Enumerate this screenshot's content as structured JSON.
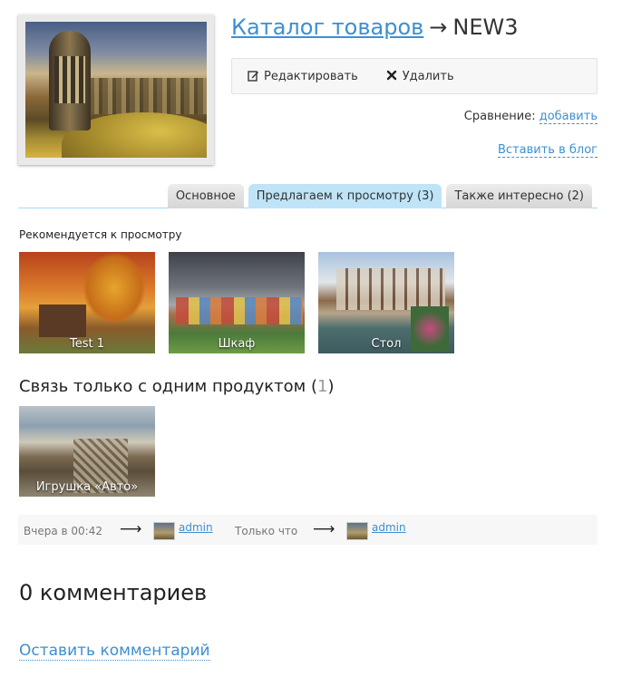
{
  "header": {
    "catalog_link": "Каталог товаров",
    "arrow": "→",
    "product_name": "NEW3"
  },
  "actions": {
    "edit_label": "Редактировать",
    "delete_label": "Удалить"
  },
  "compare": {
    "label": "Сравнение:",
    "add_link": "добавить"
  },
  "embed_link": "Вставить в блог",
  "tabs": [
    {
      "label": "Основное"
    },
    {
      "label": "Предлагаем к просмотру (3)"
    },
    {
      "label": "Также интересно (2)"
    }
  ],
  "recommended": {
    "title": "Рекомендуется к просмотру",
    "items": [
      {
        "caption": "Test 1"
      },
      {
        "caption": "Шкаф"
      },
      {
        "caption": "Стол"
      }
    ]
  },
  "relation": {
    "title": "Связь только с одним продуктом",
    "open_paren": "(",
    "count": "1",
    "close_paren": ")",
    "items": [
      {
        "caption": "Игрушка «Авто»"
      }
    ]
  },
  "history": {
    "created_time": "Вчера в 00:42",
    "created_user": "admin",
    "updated_time": "Только что",
    "updated_user": "admin",
    "arrow": "⟶"
  },
  "comments": {
    "count_text": "0 комментариев",
    "leave_link": "Оставить комментарий"
  },
  "colors": {
    "link": "#3d8fd1",
    "active_tab": "#bfe4f8",
    "tab_line": "#a9d9f3"
  }
}
